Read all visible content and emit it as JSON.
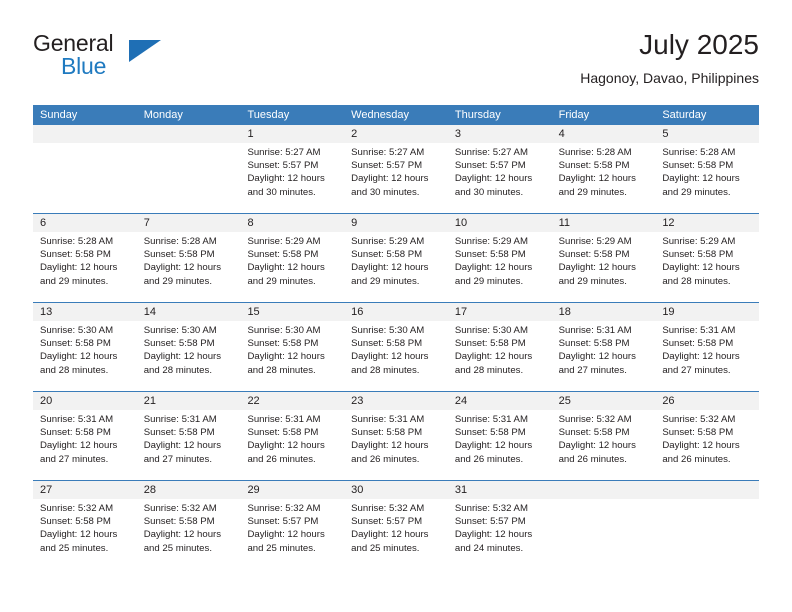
{
  "brand": {
    "word_one": "General",
    "word_two": "Blue",
    "logo_icon": "triangle-logo-icon"
  },
  "header": {
    "month_title": "July 2025",
    "location": "Hagonoy, Davao, Philippines"
  },
  "colors": {
    "header_blue": "#3a7cb9",
    "brand_blue": "#1f7ac0",
    "daynumber_gray": "#f2f2f2",
    "text": "#231f20"
  },
  "weekdays": [
    "Sunday",
    "Monday",
    "Tuesday",
    "Wednesday",
    "Thursday",
    "Friday",
    "Saturday"
  ],
  "weeks": [
    [
      {
        "day": "",
        "lines": []
      },
      {
        "day": "",
        "lines": []
      },
      {
        "day": "1",
        "lines": [
          "Sunrise: 5:27 AM",
          "Sunset: 5:57 PM",
          "Daylight: 12 hours",
          "and 30 minutes."
        ]
      },
      {
        "day": "2",
        "lines": [
          "Sunrise: 5:27 AM",
          "Sunset: 5:57 PM",
          "Daylight: 12 hours",
          "and 30 minutes."
        ]
      },
      {
        "day": "3",
        "lines": [
          "Sunrise: 5:27 AM",
          "Sunset: 5:57 PM",
          "Daylight: 12 hours",
          "and 30 minutes."
        ]
      },
      {
        "day": "4",
        "lines": [
          "Sunrise: 5:28 AM",
          "Sunset: 5:58 PM",
          "Daylight: 12 hours",
          "and 29 minutes."
        ]
      },
      {
        "day": "5",
        "lines": [
          "Sunrise: 5:28 AM",
          "Sunset: 5:58 PM",
          "Daylight: 12 hours",
          "and 29 minutes."
        ]
      }
    ],
    [
      {
        "day": "6",
        "lines": [
          "Sunrise: 5:28 AM",
          "Sunset: 5:58 PM",
          "Daylight: 12 hours",
          "and 29 minutes."
        ]
      },
      {
        "day": "7",
        "lines": [
          "Sunrise: 5:28 AM",
          "Sunset: 5:58 PM",
          "Daylight: 12 hours",
          "and 29 minutes."
        ]
      },
      {
        "day": "8",
        "lines": [
          "Sunrise: 5:29 AM",
          "Sunset: 5:58 PM",
          "Daylight: 12 hours",
          "and 29 minutes."
        ]
      },
      {
        "day": "9",
        "lines": [
          "Sunrise: 5:29 AM",
          "Sunset: 5:58 PM",
          "Daylight: 12 hours",
          "and 29 minutes."
        ]
      },
      {
        "day": "10",
        "lines": [
          "Sunrise: 5:29 AM",
          "Sunset: 5:58 PM",
          "Daylight: 12 hours",
          "and 29 minutes."
        ]
      },
      {
        "day": "11",
        "lines": [
          "Sunrise: 5:29 AM",
          "Sunset: 5:58 PM",
          "Daylight: 12 hours",
          "and 29 minutes."
        ]
      },
      {
        "day": "12",
        "lines": [
          "Sunrise: 5:29 AM",
          "Sunset: 5:58 PM",
          "Daylight: 12 hours",
          "and 28 minutes."
        ]
      }
    ],
    [
      {
        "day": "13",
        "lines": [
          "Sunrise: 5:30 AM",
          "Sunset: 5:58 PM",
          "Daylight: 12 hours",
          "and 28 minutes."
        ]
      },
      {
        "day": "14",
        "lines": [
          "Sunrise: 5:30 AM",
          "Sunset: 5:58 PM",
          "Daylight: 12 hours",
          "and 28 minutes."
        ]
      },
      {
        "day": "15",
        "lines": [
          "Sunrise: 5:30 AM",
          "Sunset: 5:58 PM",
          "Daylight: 12 hours",
          "and 28 minutes."
        ]
      },
      {
        "day": "16",
        "lines": [
          "Sunrise: 5:30 AM",
          "Sunset: 5:58 PM",
          "Daylight: 12 hours",
          "and 28 minutes."
        ]
      },
      {
        "day": "17",
        "lines": [
          "Sunrise: 5:30 AM",
          "Sunset: 5:58 PM",
          "Daylight: 12 hours",
          "and 28 minutes."
        ]
      },
      {
        "day": "18",
        "lines": [
          "Sunrise: 5:31 AM",
          "Sunset: 5:58 PM",
          "Daylight: 12 hours",
          "and 27 minutes."
        ]
      },
      {
        "day": "19",
        "lines": [
          "Sunrise: 5:31 AM",
          "Sunset: 5:58 PM",
          "Daylight: 12 hours",
          "and 27 minutes."
        ]
      }
    ],
    [
      {
        "day": "20",
        "lines": [
          "Sunrise: 5:31 AM",
          "Sunset: 5:58 PM",
          "Daylight: 12 hours",
          "and 27 minutes."
        ]
      },
      {
        "day": "21",
        "lines": [
          "Sunrise: 5:31 AM",
          "Sunset: 5:58 PM",
          "Daylight: 12 hours",
          "and 27 minutes."
        ]
      },
      {
        "day": "22",
        "lines": [
          "Sunrise: 5:31 AM",
          "Sunset: 5:58 PM",
          "Daylight: 12 hours",
          "and 26 minutes."
        ]
      },
      {
        "day": "23",
        "lines": [
          "Sunrise: 5:31 AM",
          "Sunset: 5:58 PM",
          "Daylight: 12 hours",
          "and 26 minutes."
        ]
      },
      {
        "day": "24",
        "lines": [
          "Sunrise: 5:31 AM",
          "Sunset: 5:58 PM",
          "Daylight: 12 hours",
          "and 26 minutes."
        ]
      },
      {
        "day": "25",
        "lines": [
          "Sunrise: 5:32 AM",
          "Sunset: 5:58 PM",
          "Daylight: 12 hours",
          "and 26 minutes."
        ]
      },
      {
        "day": "26",
        "lines": [
          "Sunrise: 5:32 AM",
          "Sunset: 5:58 PM",
          "Daylight: 12 hours",
          "and 26 minutes."
        ]
      }
    ],
    [
      {
        "day": "27",
        "lines": [
          "Sunrise: 5:32 AM",
          "Sunset: 5:58 PM",
          "Daylight: 12 hours",
          "and 25 minutes."
        ]
      },
      {
        "day": "28",
        "lines": [
          "Sunrise: 5:32 AM",
          "Sunset: 5:58 PM",
          "Daylight: 12 hours",
          "and 25 minutes."
        ]
      },
      {
        "day": "29",
        "lines": [
          "Sunrise: 5:32 AM",
          "Sunset: 5:57 PM",
          "Daylight: 12 hours",
          "and 25 minutes."
        ]
      },
      {
        "day": "30",
        "lines": [
          "Sunrise: 5:32 AM",
          "Sunset: 5:57 PM",
          "Daylight: 12 hours",
          "and 25 minutes."
        ]
      },
      {
        "day": "31",
        "lines": [
          "Sunrise: 5:32 AM",
          "Sunset: 5:57 PM",
          "Daylight: 12 hours",
          "and 24 minutes."
        ]
      },
      {
        "day": "",
        "lines": []
      },
      {
        "day": "",
        "lines": []
      }
    ]
  ]
}
